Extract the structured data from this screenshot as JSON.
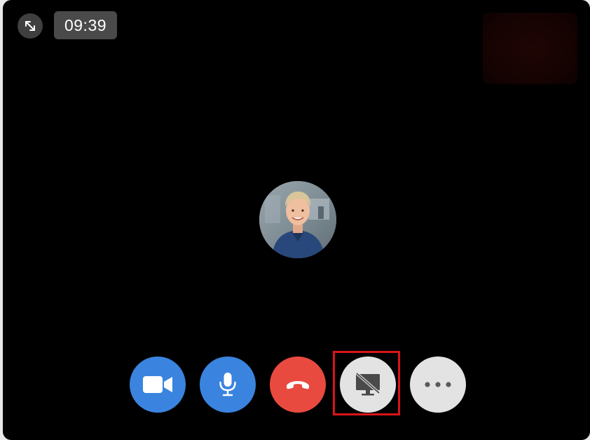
{
  "call": {
    "timer": "09:39"
  },
  "controls": {
    "video_icon": "video-camera-icon",
    "mic_icon": "microphone-icon",
    "end_icon": "phone-hangup-icon",
    "share_icon": "screen-share-off-icon",
    "more_icon": "ellipsis-icon",
    "colors": {
      "primary": "#3a84df",
      "end_call": "#e84a3f",
      "neutral": "#e3e3e3",
      "highlight": "#d9141a"
    }
  },
  "window": {
    "expand_icon": "expand-arrows-icon",
    "background": "#000000"
  }
}
